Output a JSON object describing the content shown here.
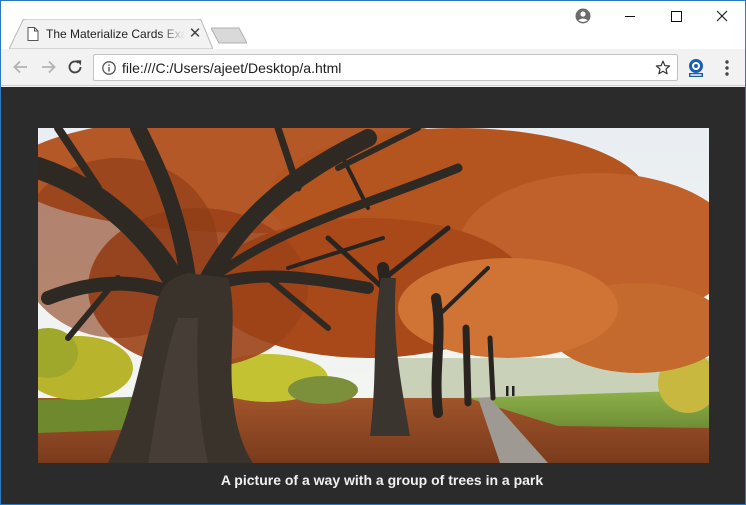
{
  "browser": {
    "tab_title": "The Materialize Cards Example",
    "url": "file:///C:/Users/ajeet/Desktop/a.html"
  },
  "page": {
    "caption": "A picture of a way with a group of trees in a park"
  },
  "icons": {
    "tab": "document-icon",
    "close_tab": "close-icon",
    "new_tab": "new-tab-icon",
    "profile": "account-circle-icon",
    "back": "arrow-left-icon",
    "forward": "arrow-right-icon",
    "reload": "reload-icon",
    "info": "info-icon",
    "bookmark": "star-icon",
    "extension": "extension-icon",
    "menu": "more-vertical-icon"
  },
  "colors": {
    "page_background": "#2b2b2b",
    "caption_text": "#f0f0f0",
    "window_border": "#2b79c2"
  }
}
